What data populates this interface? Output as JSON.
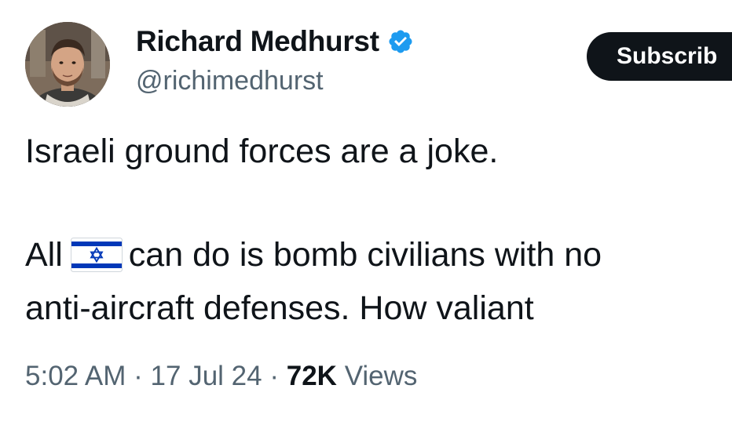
{
  "tweet": {
    "author": {
      "display_name": "Richard Medhurst",
      "handle": "@richimedhurst",
      "verified_icon": "verified-badge-icon",
      "avatar": "profile-photo"
    },
    "subscribe_label": "Subscrib",
    "text": {
      "line1": "Israeli ground forces are a joke.",
      "line2_before": "All",
      "line2_emoji": "israel-flag-emoji",
      "line2_after": "can do is bomb civilians with no",
      "line3": "anti-aircraft defenses. How valiant"
    },
    "meta": {
      "time": "5:02 AM",
      "separator": "·",
      "date": "17 Jul 24",
      "views_count": "72K",
      "views_label": "Views"
    },
    "colors": {
      "text": "#0f1419",
      "secondary": "#536471",
      "verified": "#1d9bf0",
      "button_bg": "#0f1419",
      "flag_blue": "#0038b8"
    }
  }
}
